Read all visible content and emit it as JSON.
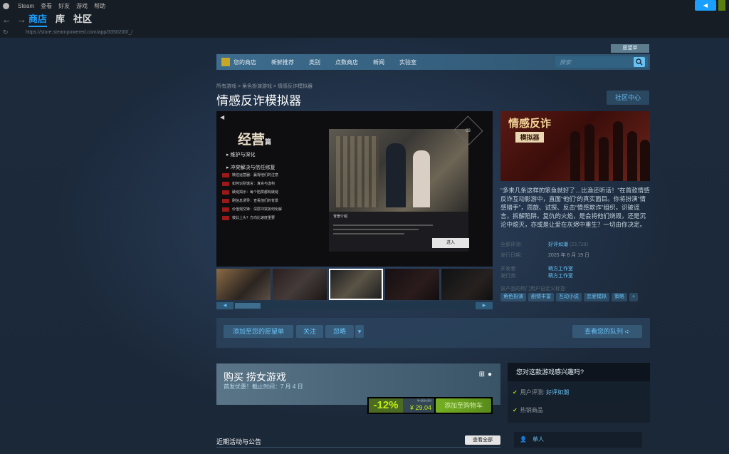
{
  "client": {
    "menu": [
      "Steam",
      "查看",
      "好友",
      "游戏",
      "帮助"
    ],
    "tabs": [
      "商店",
      "库",
      "社区"
    ],
    "url": "https://store.steampowered.com/app/3350200/_/"
  },
  "store_nav": {
    "wishlist_label": "愿望单",
    "items": [
      "您的商店",
      "新鲜推荐",
      "类别",
      "点数商店",
      "新闻",
      "实验室"
    ],
    "search_placeholder": "搜索"
  },
  "breadcrumb": "所有游戏 > 角色扮演游戏 > 情感反诈模拟器",
  "title": "情感反诈模拟器",
  "community_hub_label": "社区中心",
  "screenshot": {
    "heading": "经营",
    "heading_suffix": "篇",
    "sections": [
      "维护与深化",
      "冲突解决与信任修复"
    ],
    "rows": [
      "微信运营器：赢得他们的注意",
      "如何识别谎言：真实与虚构",
      "破绽揭示：每个陷阱都有破绽",
      "刷信息诱导：查看他们的背景",
      "价值观交锋：深层冲突如何化解",
      "彼此上头？方向比速度重要"
    ],
    "dialog_title": "背景介绍",
    "enter_label": "进入",
    "badge": "03"
  },
  "capsule": {
    "logo_line1": "情感反诈",
    "logo_line2": "模拟器"
  },
  "description": "“多来几条这样的笨鱼就好了…比渔还听话！”在首款情感反诈互动影游中，直面“他们”的真实面目。你将扮演“情感猎手”，周旋、试探、反击“情感欺诈”组织，识破谎言，拆解陷阱。复仇的火焰，是会将他们烧毁，还是沉沦中熄灭，亦或是让爱在灰烬中重生？一切由你决定。",
  "meta": {
    "reviews_label": "全部评测:",
    "reviews_value": "好评如潮",
    "reviews_count": "(23,728)",
    "release_label": "发行日期:",
    "release_value": "2025 年 6 月 19 日",
    "developer_label": "开发者:",
    "developer_value": "萌方工作室",
    "publisher_label": "发行商:",
    "publisher_value": "萌方工作室",
    "tags_label": "该产品的热门用户自定义标签:",
    "tags": [
      "角色扮演",
      "剧情丰富",
      "互动小说",
      "恋爱模拟",
      "策略",
      "+"
    ]
  },
  "actions": {
    "wishlist": "添加至您的愿望单",
    "follow": "关注",
    "ignore": "忽略",
    "queue": "查看您的队列"
  },
  "purchase": {
    "title": "购买 捞女游戏",
    "subtitle": "首发优惠！截止时间：7 月 4 日",
    "discount": "-12%",
    "original_price": "¥ 33.00",
    "final_price": "¥ 29.04",
    "cart_label": "添加至购物车"
  },
  "relevance": {
    "head": "您对这款游戏感兴趣吗?",
    "reviews_label": "用户评测:",
    "reviews_value": "好评如潮",
    "top_seller": "热销商品"
  },
  "features": {
    "singleplayer": "单人"
  },
  "news": {
    "title": "近期活动与公告",
    "view_all": "查看全部"
  }
}
